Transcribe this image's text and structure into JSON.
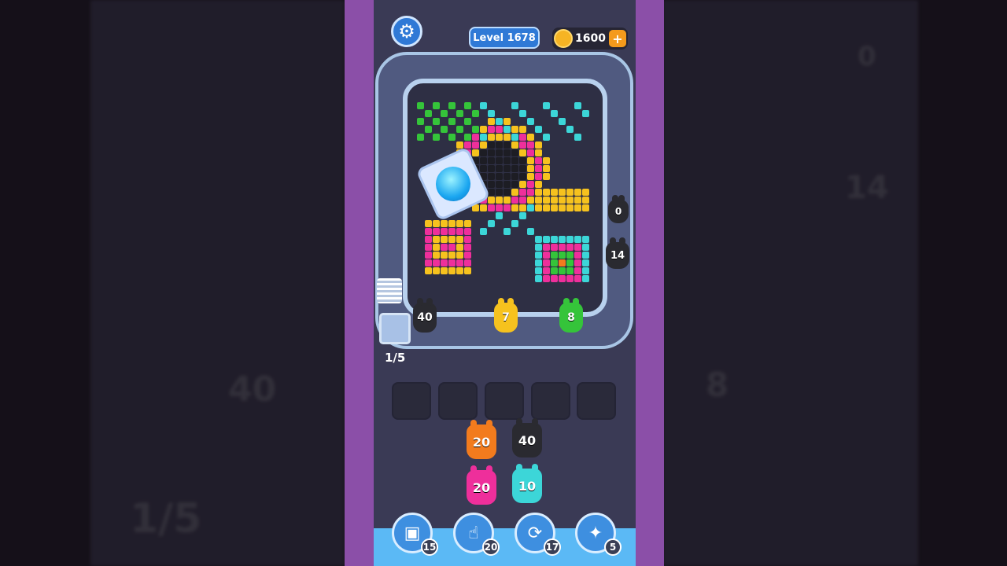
{
  "hud": {
    "level_label": "Level 1678",
    "coins": "1600",
    "coin_plus": "+",
    "settings_icon": "gear-icon"
  },
  "track": {
    "creatures": [
      {
        "id": "c40",
        "value": "40",
        "color": "dark"
      },
      {
        "id": "c7",
        "value": "7",
        "color": "yellow"
      },
      {
        "id": "c8",
        "value": "8",
        "color": "green"
      },
      {
        "id": "c0",
        "value": "0",
        "color": "dark"
      },
      {
        "id": "c14",
        "value": "14",
        "color": "dark"
      }
    ],
    "dispenser_counter": "1/5"
  },
  "queue": {
    "slots": 5,
    "columns": [
      [
        "20",
        "20"
      ],
      [
        "40",
        "10"
      ]
    ]
  },
  "boosters": [
    {
      "icon": "add-card-icon",
      "count": "15"
    },
    {
      "icon": "hand-pointer-icon",
      "count": "20"
    },
    {
      "icon": "shuffle-icon",
      "count": "17"
    },
    {
      "icon": "creature-blast-icon",
      "count": "5"
    }
  ],
  "background_ghost": {
    "left_value": "40",
    "left_counter": "1/5",
    "right_values": [
      "0",
      "14",
      "8"
    ]
  },
  "colors": {
    "accent_blue": "#2f79d6",
    "stripe_purple": "#8b4fa8",
    "coin_gold": "#f6b424"
  }
}
